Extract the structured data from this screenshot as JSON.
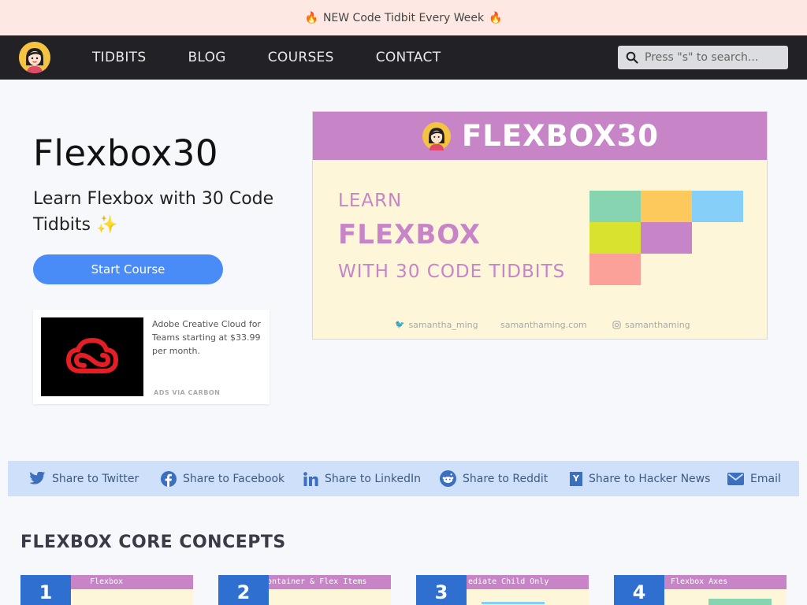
{
  "announcement": {
    "text": "NEW Code Tidbit Every Week"
  },
  "nav": {
    "links": [
      "TIDBITS",
      "BLOG",
      "COURSES",
      "CONTACT"
    ],
    "search_placeholder": "Press \"s\" to search..."
  },
  "hero": {
    "title": "Flexbox30",
    "subtitle": "Learn Flexbox with 30 Code Tidbits",
    "cta": "Start Course"
  },
  "ad": {
    "text": "Adobe Creative Cloud for Teams starting at $33.99 per month.",
    "via": "ADS VIA CARBON"
  },
  "banner": {
    "title": "FLEXBOX30",
    "learn": "LEARN",
    "flexbox": "FLEXBOX",
    "with": "WITH 30 CODE TIDBITS",
    "twitter": "samantha_ming",
    "website": "samanthaming.com",
    "instagram": "samanthaming",
    "colors": {
      "header": "#c785c7",
      "bg": "#fef6d9"
    }
  },
  "share": {
    "items": [
      {
        "label": "Share to Twitter",
        "icon": "twitter-icon"
      },
      {
        "label": "Share to Facebook",
        "icon": "facebook-icon"
      },
      {
        "label": "Share to LinkedIn",
        "icon": "linkedin-icon"
      },
      {
        "label": "Share to Reddit",
        "icon": "reddit-icon"
      },
      {
        "label": "Share to Hacker News",
        "icon": "hackernews-icon"
      },
      {
        "label": "Email",
        "icon": "email-icon"
      }
    ]
  },
  "section": {
    "title": "FLEXBOX CORE CONCEPTS"
  },
  "cards": [
    {
      "num": "1",
      "title": "Flexbox"
    },
    {
      "num": "2",
      "title": "ontainer & Flex Items"
    },
    {
      "num": "3",
      "title": "ediate Child Only"
    },
    {
      "num": "4",
      "title": "Flexbox Axes"
    }
  ]
}
